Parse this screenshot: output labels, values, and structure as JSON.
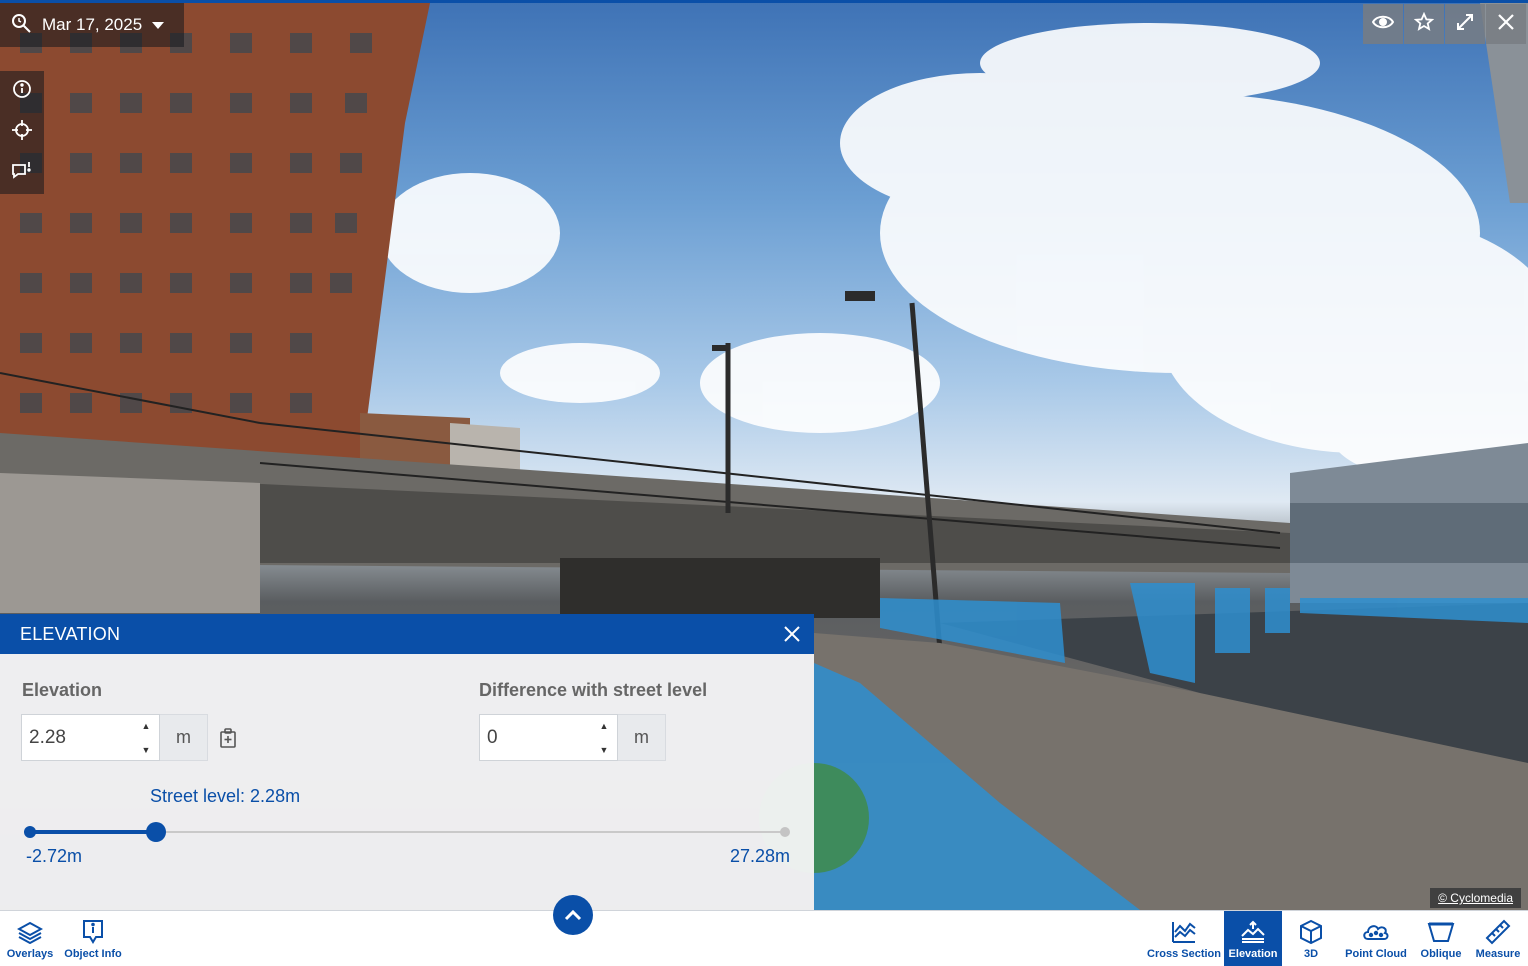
{
  "viewer": {
    "date": "Mar 17, 2025",
    "copyright": "© Cyclomedia"
  },
  "elevation_panel": {
    "title": "ELEVATION",
    "elevation_label": "Elevation",
    "elevation_value": "2.28",
    "elevation_unit": "m",
    "difference_label": "Difference with street level",
    "difference_value": "0",
    "difference_unit": "m",
    "street_level_text": "Street level: 2.28m",
    "range_min_label": "-2.72m",
    "range_max_label": "27.28m",
    "slider_min": -2.72,
    "slider_max": 27.28,
    "slider_value": 2.28
  },
  "left_tools": [
    "zoom-history-icon",
    "info-icon",
    "crosshair-icon",
    "comment-icon"
  ],
  "top_right_tools": [
    "eye-icon",
    "star-icon",
    "expand-icon",
    "close-icon"
  ],
  "bottom_toolbar": {
    "overlays": "Overlays",
    "object_info": "Object Info",
    "cross_section": "Cross Section",
    "elevation": "Elevation",
    "three_d": "3D",
    "point_cloud": "Point Cloud",
    "oblique": "Oblique",
    "measure": "Measure"
  },
  "colors": {
    "accent": "#0a4fa8",
    "water_highlight": "#2e8fd0"
  }
}
